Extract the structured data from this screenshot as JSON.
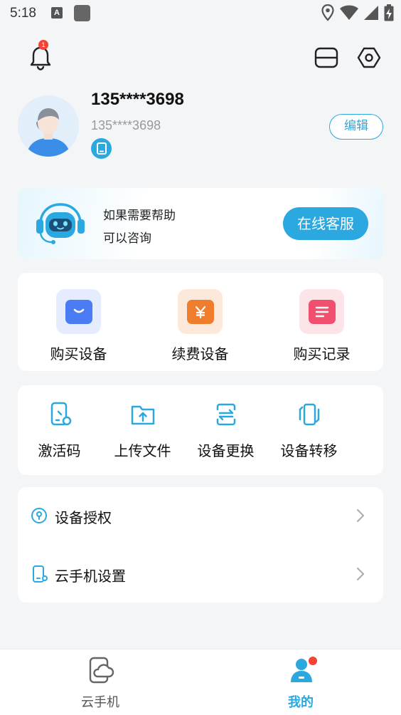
{
  "status_bar": {
    "time": "5:18",
    "left_icons": [
      "notification-a-icon",
      "app-square-icon"
    ],
    "right_icons": [
      "location-icon",
      "wifi-icon",
      "signal-icon",
      "battery-charging-icon"
    ]
  },
  "top_bar": {
    "notification_count": "1",
    "icons": [
      "bell-icon",
      "scan-icon",
      "settings-gear-icon"
    ]
  },
  "profile": {
    "display_name": "135****3698",
    "account": "135****3698",
    "edit_label": "编辑"
  },
  "help": {
    "line1": "如果需要帮助",
    "line2": "可以咨询",
    "button_label": "在线客服"
  },
  "shop": {
    "items": [
      {
        "label": "购买设备",
        "icon": "shopping-bag-icon",
        "color": "#4a7cf3"
      },
      {
        "label": "续费设备",
        "icon": "yen-icon",
        "color": "#f07d2b"
      },
      {
        "label": "购买记录",
        "icon": "records-list-icon",
        "color": "#f0506e"
      }
    ]
  },
  "tools": {
    "items": [
      {
        "label": "激活码",
        "icon": "activation-code-icon"
      },
      {
        "label": "上传文件",
        "icon": "upload-folder-icon"
      },
      {
        "label": "设备更换",
        "icon": "device-swap-icon"
      },
      {
        "label": "设备转移",
        "icon": "device-transfer-icon"
      }
    ]
  },
  "menu": {
    "items": [
      {
        "label": "设备授权",
        "icon": "authorization-lock-icon"
      },
      {
        "label": "云手机设置",
        "icon": "cloud-phone-settings-icon"
      }
    ]
  },
  "tabbar": {
    "tabs": [
      {
        "label": "云手机",
        "icon": "cloud-phone-tab-icon",
        "active": false
      },
      {
        "label": "我的",
        "icon": "profile-tab-icon",
        "active": true
      }
    ]
  },
  "colors": {
    "accent": "#2aa8df",
    "badge_red": "#f44336",
    "background": "#f4f5f7"
  }
}
